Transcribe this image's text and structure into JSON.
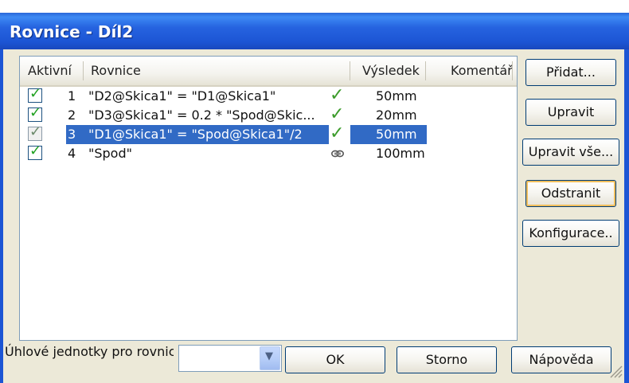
{
  "window": {
    "title": "Rovnice - Díl2"
  },
  "table": {
    "headers": {
      "active": "Aktivní",
      "equation": "Rovnice",
      "result": "Výsledek",
      "comment": "Komentář"
    },
    "rows": [
      {
        "index": "1",
        "equation": "\"D2@Skica1\" = \"D1@Skica1\"",
        "status_icon": "valid-icon",
        "result": "50mm",
        "comment": "",
        "active": true,
        "selected": false
      },
      {
        "index": "2",
        "equation": "\"D3@Skica1\" = 0.2 * \"Spod@Skic...",
        "status_icon": "valid-icon",
        "result": "20mm",
        "comment": "",
        "active": true,
        "selected": false
      },
      {
        "index": "3",
        "equation": "\"D1@Skica1\" = \"Spod@Skica1\"/2",
        "status_icon": "valid-icon",
        "result": "50mm",
        "comment": "",
        "active": true,
        "selected": true
      },
      {
        "index": "4",
        "equation": "\"Spod\"",
        "status_icon": "link-icon",
        "result": "100mm",
        "comment": "",
        "active": true,
        "selected": false
      }
    ]
  },
  "buttons": {
    "add": "Přidat...",
    "edit": "Upravit",
    "edit_all": "Upravit vše...",
    "delete": "Odstranit",
    "configurations": "Konfigurace..",
    "ok": "OK",
    "cancel": "Storno",
    "help": "Nápověda"
  },
  "angular_units": {
    "label": "Úhlové jednotky pro rovnic",
    "value": ""
  },
  "colors": {
    "title_bar": "#1c55d4",
    "selection": "#316ac5",
    "check": "#21a121",
    "focus_border": "#f0be5c"
  }
}
